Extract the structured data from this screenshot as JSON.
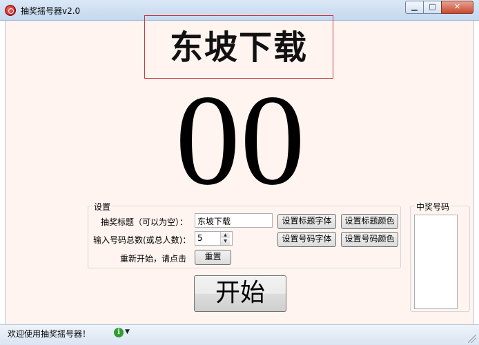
{
  "window": {
    "title": "抽奖摇号器v2.0",
    "minimize_glyph": "▁",
    "maximize_glyph": "□",
    "close_glyph": "✕"
  },
  "banner": {
    "title": "东坡下载"
  },
  "display": {
    "number": "00"
  },
  "settings": {
    "group_label": "设置",
    "title_label": "抽奖标题（可以为空）：",
    "title_value": "东坡下载",
    "set_title_font": "设置标题字体",
    "set_title_color": "设置标题颜色",
    "total_label": "输入号码总数(或总人数)：",
    "total_value": "5",
    "set_number_font": "设置号码字体",
    "set_number_color": "设置号码颜色",
    "restart_label": "重新开始，请点击",
    "reset_button": "重置"
  },
  "start_button": "开始",
  "winners": {
    "group_label": "中奖号码"
  },
  "statusbar": {
    "text": "欢迎使用抽奖摇号器！",
    "info_glyph": "i",
    "dropdown_glyph": "▼"
  }
}
